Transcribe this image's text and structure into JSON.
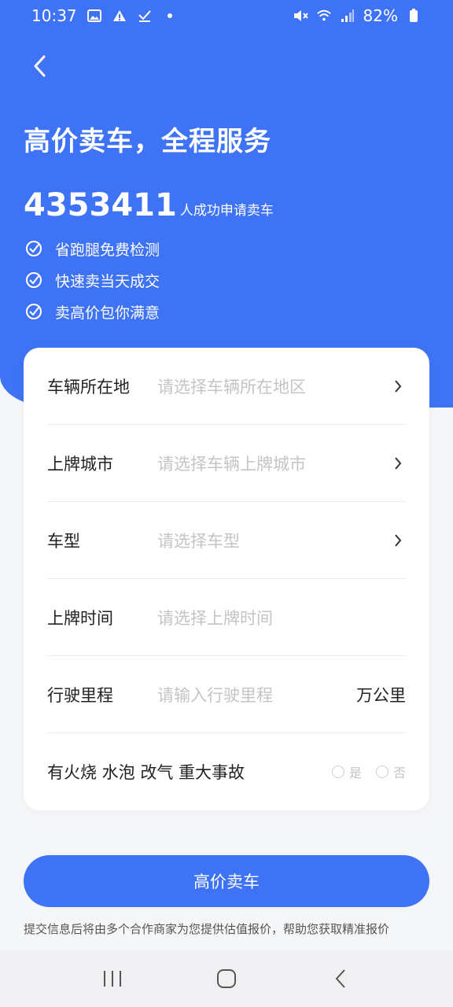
{
  "status_bar": {
    "time": "10:37",
    "battery": "82%",
    "icons": [
      "image-icon",
      "warning-icon",
      "check-icon",
      "dot-icon",
      "mute-icon",
      "wifi-icon",
      "signal-icon",
      "battery-icon"
    ]
  },
  "header": {
    "title": "高价卖车，全程服务",
    "count": "4353411",
    "count_text": "人成功申请卖车",
    "features": [
      "省跑腿免费检测",
      "快速卖当天成交",
      "卖高价包你满意"
    ]
  },
  "form": {
    "location": {
      "label": "车辆所在地",
      "placeholder": "请选择车辆所在地区"
    },
    "plate_city": {
      "label": "上牌城市",
      "placeholder": "请选择车辆上牌城市"
    },
    "model": {
      "label": "车型",
      "placeholder": "请选择车型"
    },
    "plate_time": {
      "label": "上牌时间",
      "placeholder": "请选择上牌时间"
    },
    "mileage": {
      "label": "行驶里程",
      "placeholder": "请输入行驶里程",
      "unit": "万公里"
    },
    "accident": {
      "label": "有火烧 水泡 改气 重大事故",
      "yes": "是",
      "no": "否"
    }
  },
  "submit_label": "高价卖车",
  "notice": "提交信息后将由多个合作商家为您提供估值报价，帮助您获取精准报价",
  "colors": {
    "primary": "#3e73f5",
    "placeholder": "#c4c4c4"
  }
}
